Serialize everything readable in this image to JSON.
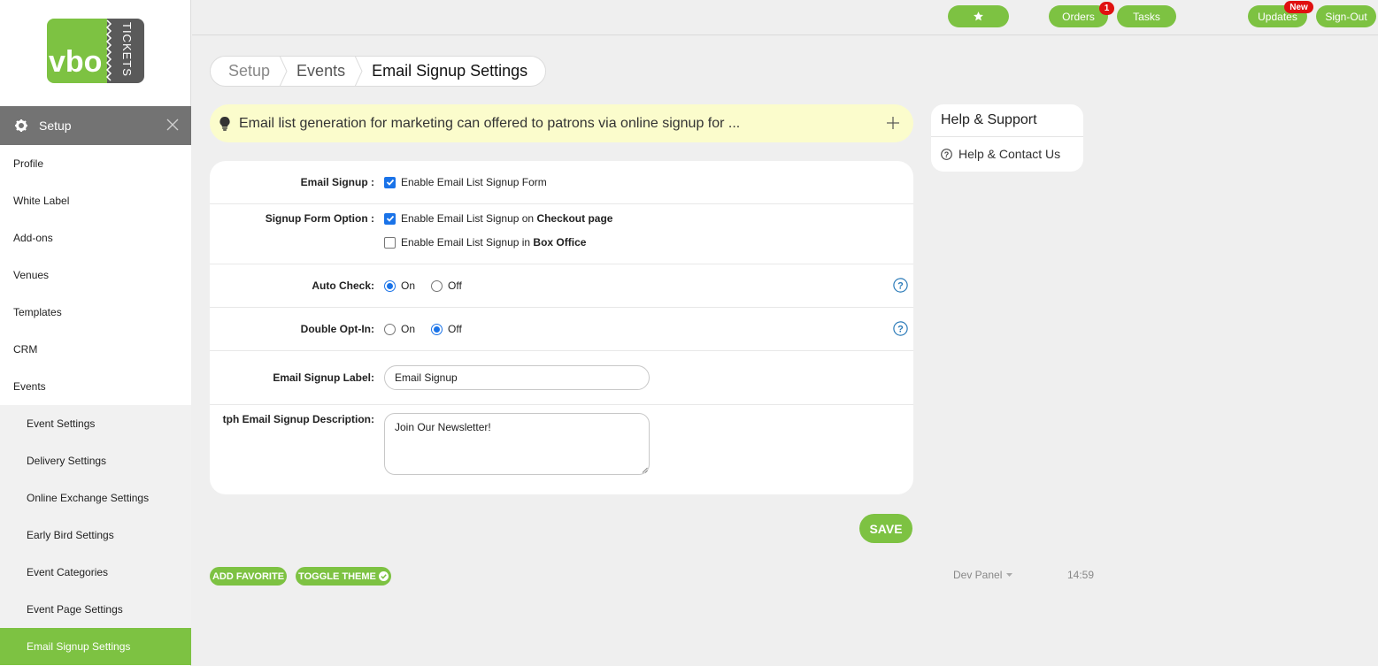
{
  "logo": {
    "text_vbo": "vbo",
    "text_tickets": "TICKETS"
  },
  "sidebar": {
    "section": "Setup",
    "items": [
      {
        "label": "Profile"
      },
      {
        "label": "White Label"
      },
      {
        "label": "Add-ons"
      },
      {
        "label": "Venues"
      },
      {
        "label": "Templates"
      },
      {
        "label": "CRM"
      },
      {
        "label": "Events"
      }
    ],
    "subitems": [
      {
        "label": "Event Settings"
      },
      {
        "label": "Delivery Settings"
      },
      {
        "label": "Online Exchange Settings"
      },
      {
        "label": "Early Bird Settings"
      },
      {
        "label": "Event Categories"
      },
      {
        "label": "Event Page Settings"
      },
      {
        "label": "Email Signup Settings",
        "active": true
      }
    ]
  },
  "topbar": {
    "orders": "Orders",
    "orders_badge": "1",
    "tasks": "Tasks",
    "updates": "Updates",
    "updates_badge": "New",
    "signout": "Sign-Out"
  },
  "breadcrumb": [
    "Setup",
    "Events",
    "Email Signup Settings"
  ],
  "banner": {
    "text": "Email list generation for marketing can offered to patrons via online signup for ..."
  },
  "form": {
    "email_signup": {
      "label": "Email Signup :",
      "option": "Enable Email List Signup Form",
      "checked": true
    },
    "signup_form_option": {
      "label": "Signup Form Option :",
      "opt1_prefix": "Enable Email List Signup on ",
      "opt1_bold": "Checkout page",
      "opt2_prefix": "Enable Email List Signup in ",
      "opt2_bold": "Box Office"
    },
    "auto_check": {
      "label": "Auto Check:",
      "on": "On",
      "off": "Off",
      "selected": "On"
    },
    "double_opt_in": {
      "label": "Double Opt-In:",
      "on": "On",
      "off": "Off",
      "selected": "Off"
    },
    "signup_label": {
      "label": "Email Signup Label:",
      "value": "Email Signup"
    },
    "signup_description": {
      "label": "tph Email Signup Description:",
      "value": "Join Our Newsletter!"
    },
    "save": "SAVE"
  },
  "help": {
    "title": "Help & Support",
    "link": "Help & Contact Us"
  },
  "footer": {
    "add_favorite": "ADD FAVORITE",
    "toggle_theme": "TOGGLE THEME",
    "dev_panel": "Dev Panel",
    "time": "14:59"
  },
  "colors": {
    "accent": "#7dc242",
    "badge": "#e01010",
    "banner": "#fbfccc",
    "checkbox": "#1a73e8",
    "help_icon": "#2a7ab8"
  }
}
